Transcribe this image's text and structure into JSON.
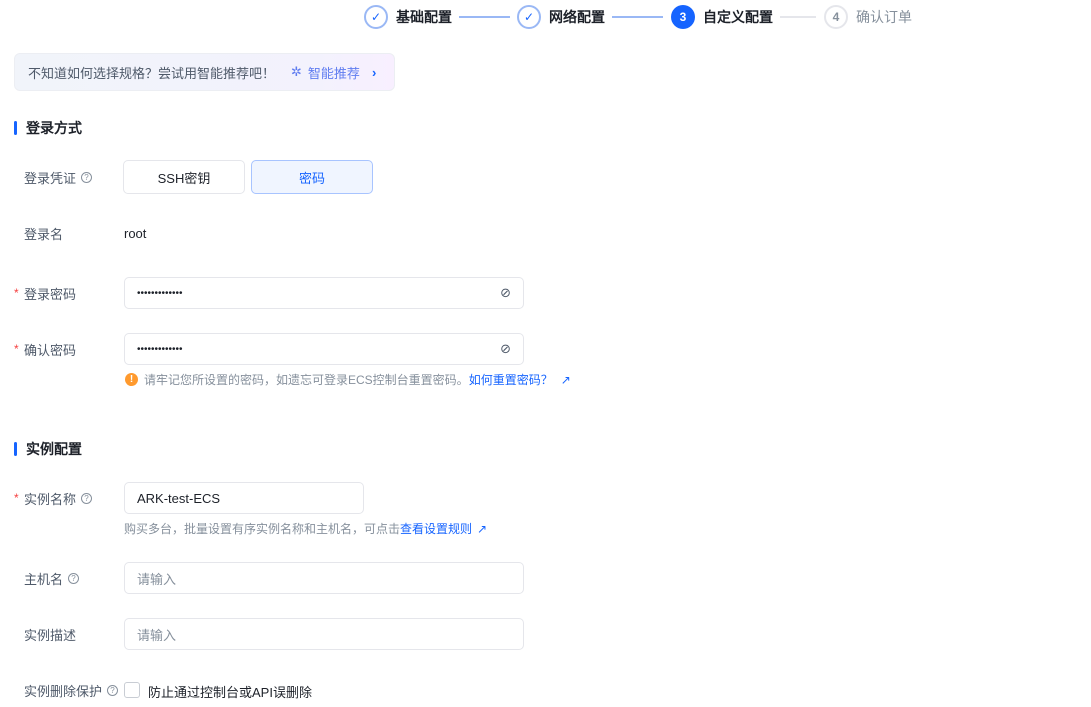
{
  "steps": [
    {
      "num": "1",
      "label": "基础配置",
      "state": "done"
    },
    {
      "num": "2",
      "label": "网络配置",
      "state": "done"
    },
    {
      "num": "3",
      "label": "自定义配置",
      "state": "active"
    },
    {
      "num": "4",
      "label": "确认订单",
      "state": "todo"
    }
  ],
  "banner": {
    "text": "不知道如何选择规格？尝试用智能推荐吧！",
    "link": "智能推荐"
  },
  "login": {
    "section": "登录方式",
    "credential_label": "登录凭证",
    "options": [
      "SSH密钥",
      "密码"
    ],
    "selected": "密码",
    "username_label": "登录名",
    "username": "root",
    "password_label": "登录密码",
    "password_value": "•••••••••••••",
    "confirm_label": "确认密码",
    "confirm_value": "•••••••••••••",
    "hint": "请牢记您所设置的密码，如遗忘可登录ECS控制台重置密码。",
    "hint_link": "如何重置密码？"
  },
  "instance": {
    "section": "实例配置",
    "name_label": "实例名称",
    "name_value": "ARK-test-ECS",
    "name_hint": "购买多台，批量设置有序实例名称和主机名，可点击",
    "name_hint_link": "查看设置规则",
    "host_label": "主机名",
    "host_placeholder": "请输入",
    "desc_label": "实例描述",
    "desc_placeholder": "请输入",
    "protect_label": "实例删除保护",
    "protect_text": "防止通过控制台或API误删除"
  },
  "colors": {
    "primary": "#1664ff",
    "required": "#f53f3f",
    "warning": "#ff9a2e"
  }
}
